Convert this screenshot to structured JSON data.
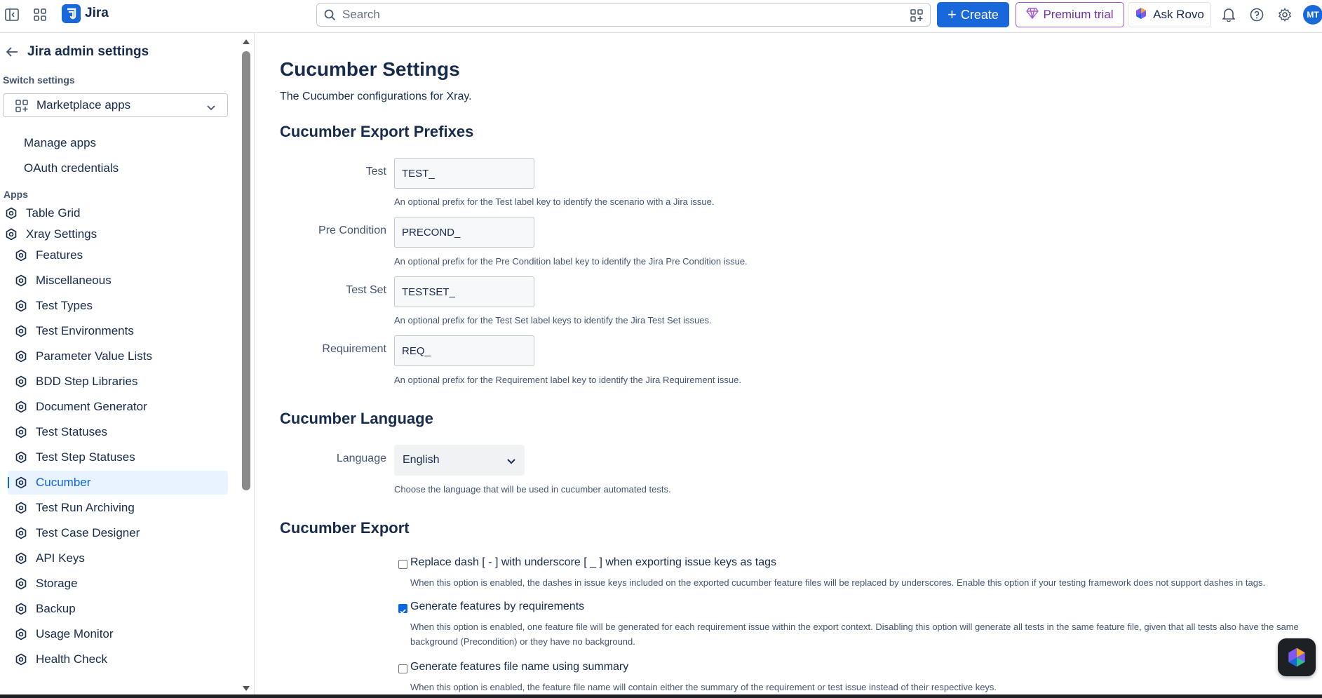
{
  "topbar": {
    "app_name": "Jira",
    "search_placeholder": "Search",
    "create_label": "Create",
    "premium_label": "Premium trial",
    "rovo_label": "Ask Rovo",
    "avatar_initials": "MT",
    "brand_color": "#1868db"
  },
  "sidebar": {
    "back_title": "Jira admin settings",
    "switch_label": "Switch settings",
    "switch_value": "Marketplace apps",
    "links": [
      "Manage apps",
      "OAuth credentials"
    ],
    "apps_label": "Apps",
    "top_items": [
      "Table Grid",
      "Xray Settings"
    ],
    "xray_items": [
      "Features",
      "Miscellaneous",
      "Test Types",
      "Test Environments",
      "Parameter Value Lists",
      "BDD Step Libraries",
      "Document Generator",
      "Test Statuses",
      "Test Step Statuses",
      "Cucumber",
      "Test Run Archiving",
      "Test Case Designer",
      "API Keys",
      "Storage",
      "Backup",
      "Usage Monitor",
      "Health Check"
    ],
    "active_item": "Cucumber"
  },
  "main": {
    "title": "Cucumber Settings",
    "description": "The Cucumber configurations for Xray.",
    "prefixes_heading": "Cucumber Export Prefixes",
    "fields": [
      {
        "label": "Test",
        "value": "TEST_",
        "help": "An optional prefix for the Test label key to identify the scenario with a Jira issue."
      },
      {
        "label": "Pre Condition",
        "value": "PRECOND_",
        "help": "An optional prefix for the Pre Condition label key to identify the Jira Pre Condition issue."
      },
      {
        "label": "Test Set",
        "value": "TESTSET_",
        "help": "An optional prefix for the Test Set label keys to identify the Jira Test Set issues."
      },
      {
        "label": "Requirement",
        "value": "REQ_",
        "help": "An optional prefix for the Requirement label key to identify the Jira Requirement issue."
      }
    ],
    "language_heading": "Cucumber Language",
    "language_label": "Language",
    "language_value": "English",
    "language_help": "Choose the language that will be used in cucumber automated tests.",
    "export_heading": "Cucumber Export",
    "options": [
      {
        "label": "Replace dash [ - ] with underscore [ _ ] when exporting issue keys as tags",
        "checked": false,
        "help": "When this option is enabled, the dashes in issue keys included on the exported cucumber feature files will be replaced by underscores. Enable this option if your testing framework does not support dashes in tags."
      },
      {
        "label": "Generate features by requirements",
        "checked": true,
        "help": "When this option is enabled, one feature file will be generated for each requirement issue within the export context. Disabling this option will generate all tests in the same feature file, given that all tests also have the same background (Precondition) or they have no background."
      },
      {
        "label": "Generate features file name using summary",
        "checked": false,
        "help": "When this option is enabled, the feature file name will contain either the summary of the requirement or test issue instead of their respective keys."
      }
    ]
  }
}
